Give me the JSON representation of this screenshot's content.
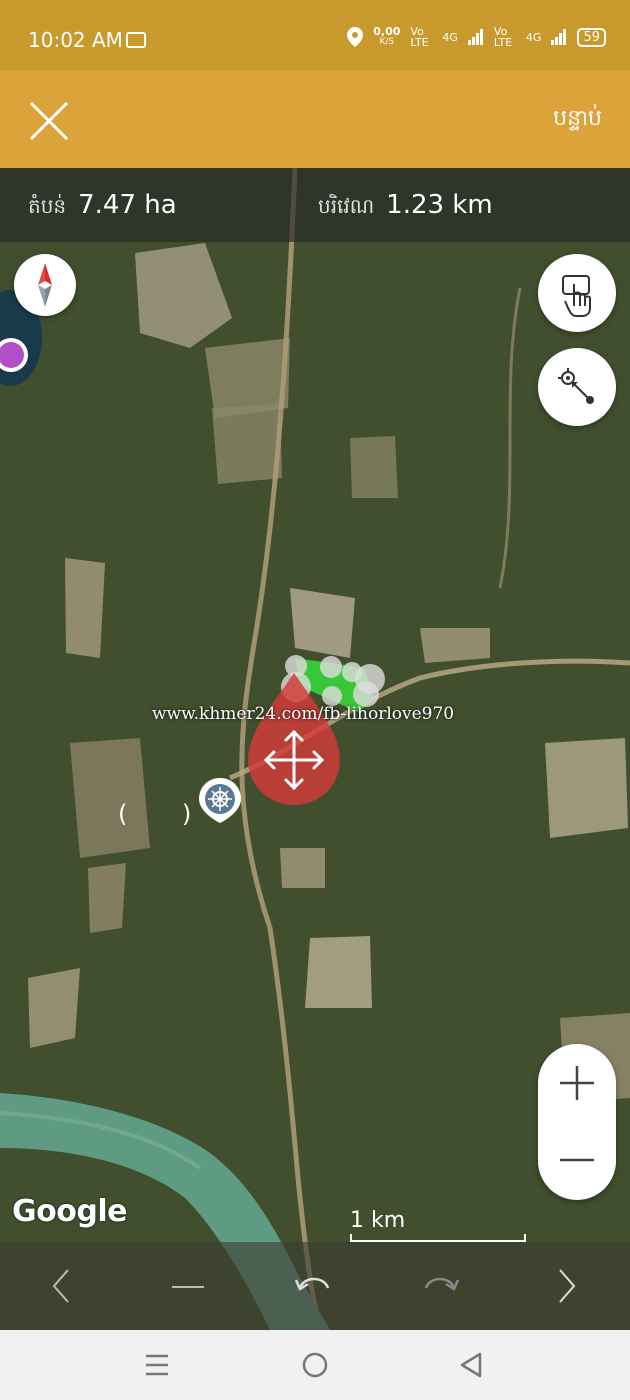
{
  "status_bar": {
    "time": "10:02 AM",
    "data_speed": "0,00",
    "data_unit": "K/S",
    "sim1": "Vo LTE",
    "sim1_net": "4G",
    "sim2": "Vo LTE",
    "sim2_net": "4G",
    "battery": "59"
  },
  "header": {
    "close_icon": "close-icon",
    "next_label": "បន្ទាប់"
  },
  "metrics": {
    "area_label": "តំបន់",
    "area_value": "7.47 ha",
    "perimeter_label": "បរិវេណ",
    "perimeter_value": "1.23 km"
  },
  "map": {
    "watermark": "www.khmer24.com/fb-lihorlove970",
    "google_logo": "Google",
    "scale_label": "1 km",
    "pin_left": "(",
    "pin_right": ")"
  },
  "colors": {
    "status_bar": "#c8992c",
    "header": "#dca33b",
    "polygon": "#38d33a",
    "drag_marker": "#d43b3b"
  }
}
